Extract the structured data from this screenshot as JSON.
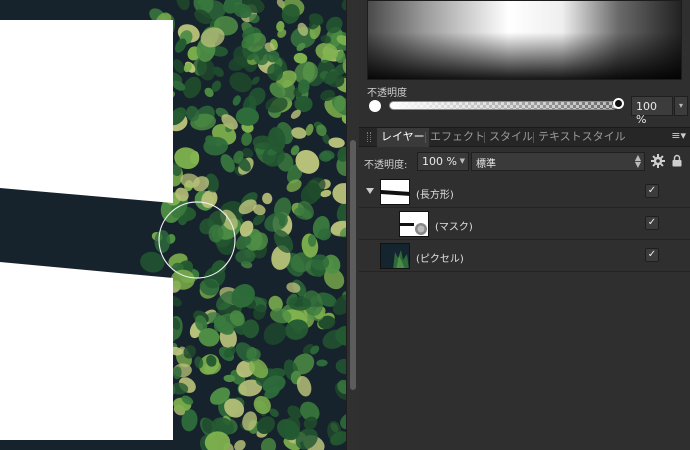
{
  "color_panel": {
    "opacity_label": "不透明度",
    "opacity_value": "100 %",
    "opacity_level": 1.0
  },
  "tabs": [
    {
      "label": "レイヤー",
      "active": true
    },
    {
      "label": "エフェクト",
      "active": false
    },
    {
      "label": "スタイル",
      "active": false
    },
    {
      "label": "テキストスタイル",
      "active": false
    }
  ],
  "layer_options": {
    "opacity_label": "不透明度:",
    "opacity_value": "100 %",
    "blend_mode": "標準"
  },
  "layers": [
    {
      "name": "(長方形)",
      "visible": true,
      "expanded": true,
      "indent": 0
    },
    {
      "name": "(マスク)",
      "visible": true,
      "expanded": false,
      "indent": 1
    },
    {
      "name": "(ピクセル)",
      "visible": true,
      "expanded": false,
      "indent": 0
    }
  ],
  "icons": {
    "panel_menu": "menu-icon",
    "settings": "gear-icon",
    "lock": "lock-icon",
    "check": "checkmark-icon"
  },
  "colors": {
    "panel_bg": "#2f2f2f",
    "tab_bar_bg": "#262626",
    "leaf_dark": "#1f4a2c",
    "leaf_mid": "#3a7a3e",
    "leaf_light": "#7fb24e",
    "wall": "#16222c"
  }
}
